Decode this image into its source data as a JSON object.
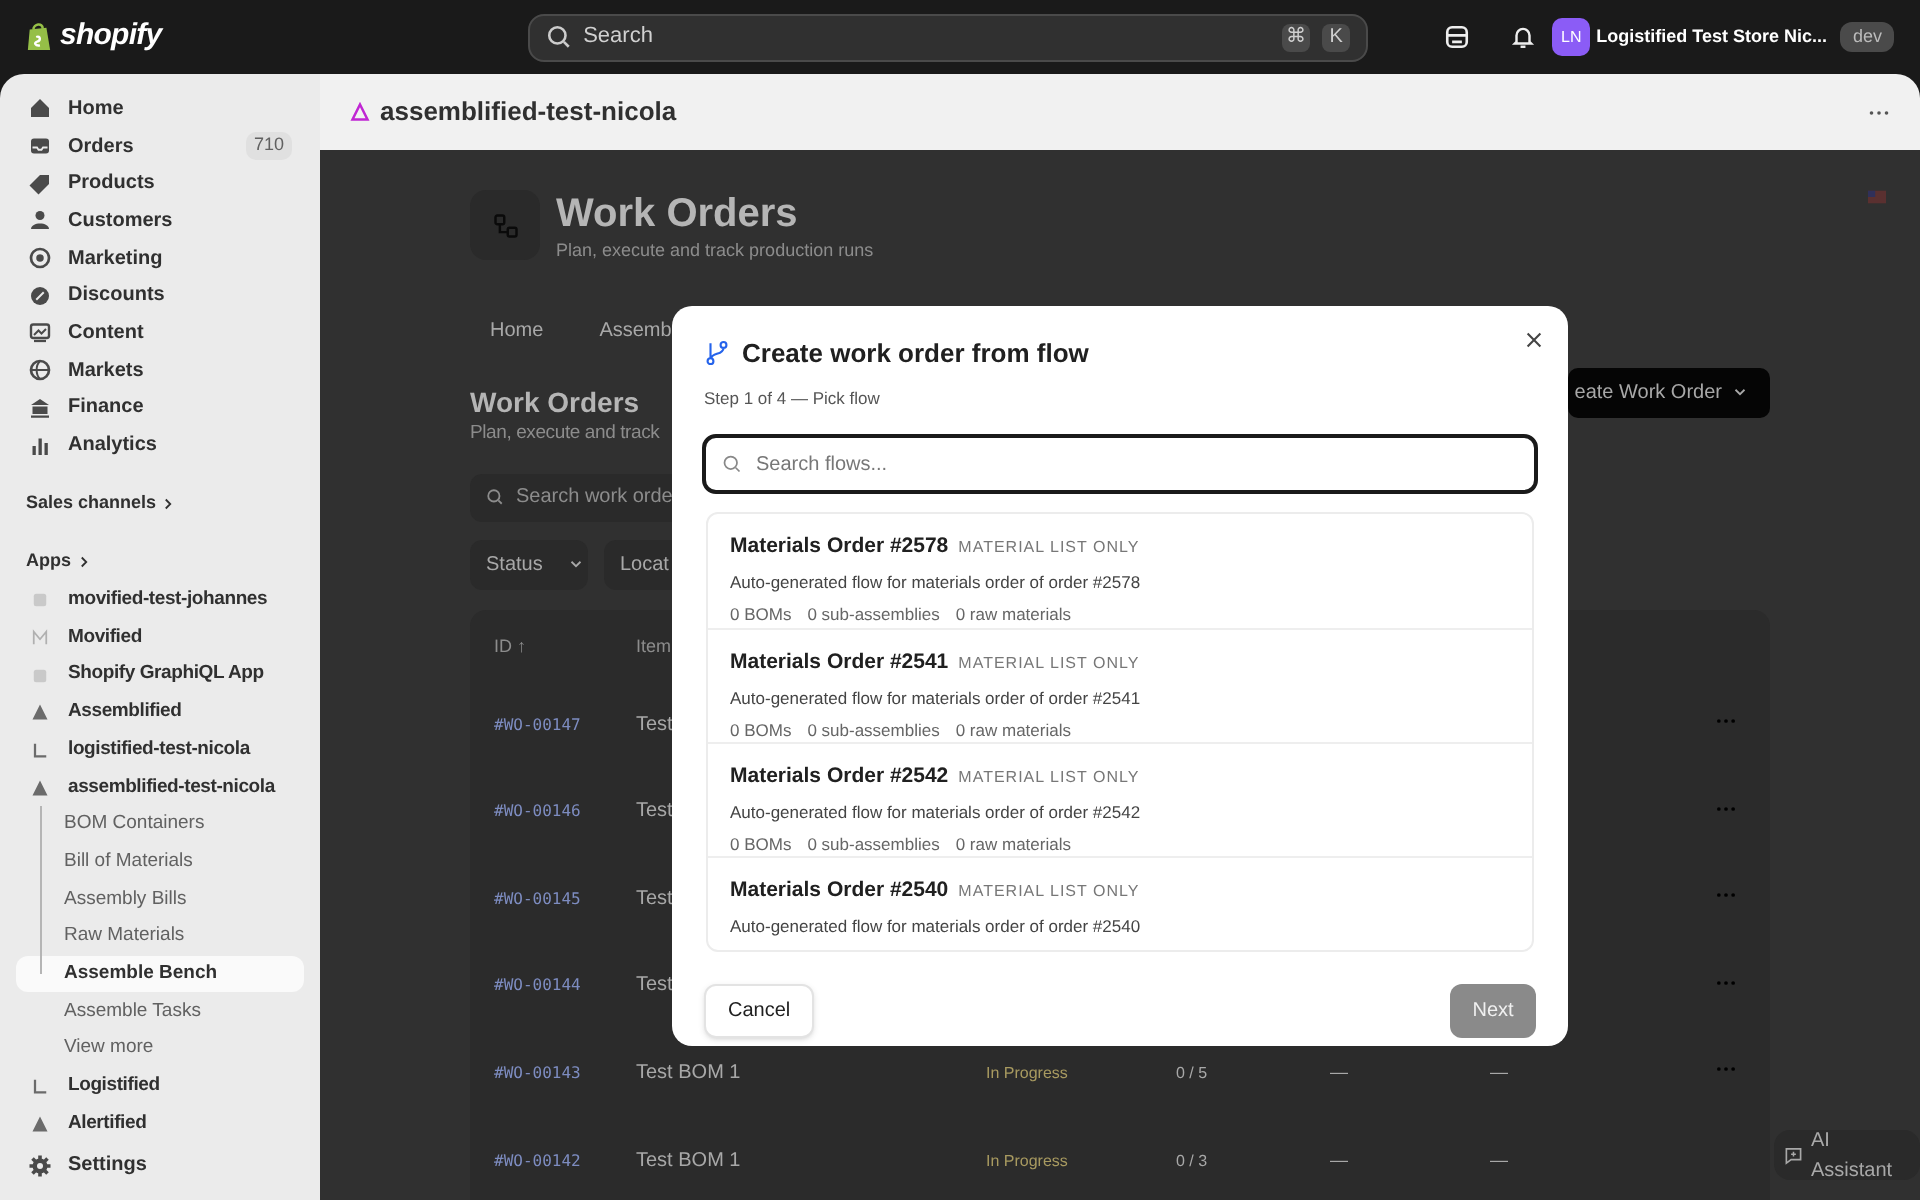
{
  "topbar": {
    "logo": "shopify",
    "search": {
      "placeholder": "Search",
      "keys": [
        "⌘",
        "K"
      ]
    },
    "store": {
      "initials": "LN",
      "name": "Logistified Test Store Nic...",
      "badge": "dev"
    }
  },
  "sidebar": {
    "nav": [
      {
        "label": "Home"
      },
      {
        "label": "Orders",
        "badge": "710"
      },
      {
        "label": "Products"
      },
      {
        "label": "Customers"
      },
      {
        "label": "Marketing"
      },
      {
        "label": "Discounts"
      },
      {
        "label": "Content"
      },
      {
        "label": "Markets"
      },
      {
        "label": "Finance"
      },
      {
        "label": "Analytics"
      }
    ],
    "sales_channels": "Sales channels",
    "apps_heading": "Apps",
    "apps": [
      {
        "label": "movified-test-johannes"
      },
      {
        "label": "Movified"
      },
      {
        "label": "Shopify GraphiQL App"
      },
      {
        "label": "Assemblified"
      },
      {
        "label": "logistified-test-nicola"
      },
      {
        "label": "assemblified-test-nicola",
        "children": [
          {
            "label": "BOM Containers",
            "selected": false
          },
          {
            "label": "Bill of Materials",
            "selected": false
          },
          {
            "label": "Assembly Bills",
            "selected": false
          },
          {
            "label": "Raw Materials",
            "selected": false
          },
          {
            "label": "Assemble Bench",
            "selected": true
          },
          {
            "label": "Assemble Tasks",
            "selected": false
          },
          {
            "label": "View more",
            "selected": false
          }
        ]
      },
      {
        "label": "Logistified"
      },
      {
        "label": "Alertified"
      }
    ],
    "settings": "Settings"
  },
  "app_header": {
    "title": "assemblified-test-nicola"
  },
  "page": {
    "title": "Work Orders",
    "subtitle": "Plan, execute and track production runs",
    "tabs": [
      "Home",
      "Assemb"
    ],
    "section_title": "Work Orders",
    "section_subtitle": "Plan, execute and track",
    "create_button": "eate Work Order",
    "search_placeholder": "Search work orde",
    "filters": [
      "Status",
      "Locat"
    ],
    "table": {
      "columns": [
        "ID ↑",
        "Item"
      ],
      "rows": [
        {
          "id": "#WO-00147",
          "item": "Test",
          "actions": true
        },
        {
          "id": "#WO-00146",
          "item": "Test",
          "actions": true
        },
        {
          "id": "#WO-00145",
          "item": "Test",
          "actions": true
        },
        {
          "id": "#WO-00144",
          "item": "Test",
          "actions": true
        },
        {
          "id": "#WO-00143",
          "item": "Test BOM 1",
          "status": "In Progress",
          "progress": "0 / 5",
          "col_5": "—",
          "col_6": "—",
          "actions": true
        },
        {
          "id": "#WO-00142",
          "item": "Test BOM 1",
          "status": "In Progress",
          "progress": "0 / 3",
          "col_5": "—",
          "col_6": "—",
          "actions": false
        }
      ]
    }
  },
  "modal": {
    "title": "Create work order from flow",
    "step": "Step 1 of 4 — Pick flow",
    "search_placeholder": "Search flows...",
    "flows": [
      {
        "title": "Materials Order #2578",
        "tag": "MATERIAL LIST ONLY",
        "description": "Auto-generated flow for materials order of order #2578",
        "stats": [
          "0 BOMs",
          "0 sub-assemblies",
          "0 raw materials"
        ]
      },
      {
        "title": "Materials Order #2541",
        "tag": "MATERIAL LIST ONLY",
        "description": "Auto-generated flow for materials order of order #2541",
        "stats": [
          "0 BOMs",
          "0 sub-assemblies",
          "0 raw materials"
        ]
      },
      {
        "title": "Materials Order #2542",
        "tag": "MATERIAL LIST ONLY",
        "description": "Auto-generated flow for materials order of order #2542",
        "stats": [
          "0 BOMs",
          "0 sub-assemblies",
          "0 raw materials"
        ]
      },
      {
        "title": "Materials Order #2540",
        "tag": "MATERIAL LIST ONLY",
        "description": "Auto-generated flow for materials order of order #2540"
      }
    ],
    "cancel": "Cancel",
    "next": {
      "label": "Next",
      "disabled": true
    }
  },
  "ai_assistant": "AI Assistant"
}
